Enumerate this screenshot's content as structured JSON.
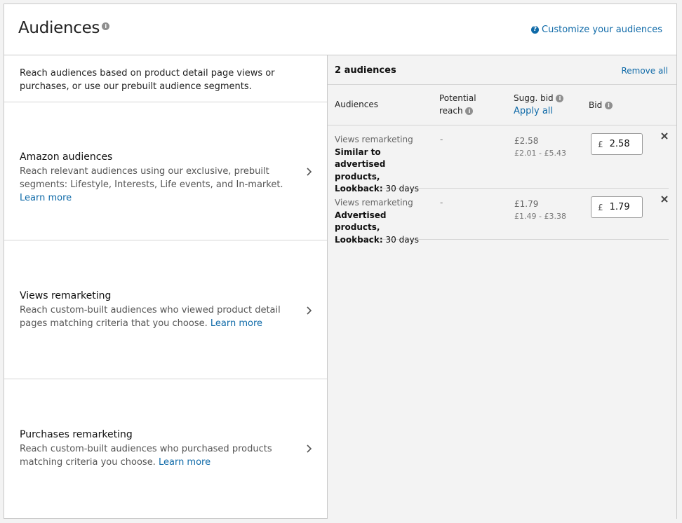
{
  "header": {
    "title": "Audiences",
    "info_icon": "info-icon",
    "customize_label": "Customize your audiences",
    "customize_icon": "help-icon"
  },
  "left": {
    "intro": "Reach audiences based on product detail page views or purchases, or use our prebuilt audience segments.",
    "options": [
      {
        "name": "Amazon audiences",
        "desc": "Reach relevant audiences using our exclusive, prebuilt segments: Lifestyle, Interests, Life events, and In-market.",
        "link": "Learn more"
      },
      {
        "name": "Views remarketing",
        "desc": "Reach custom-built audiences who viewed product detail pages matching criteria that you choose.",
        "link": "Learn more"
      },
      {
        "name": "Purchases remarketing",
        "desc": "Reach custom-built audiences who purchased products matching criteria you choose.",
        "link": "Learn more"
      }
    ]
  },
  "right": {
    "count_label": "2 audiences",
    "remove_all": "Remove all",
    "columns": {
      "audiences": "Audiences",
      "reach_line1": "Potential",
      "reach_line2": "reach",
      "sugg": "Sugg. bid",
      "apply_all": "Apply all",
      "bid": "Bid"
    },
    "rows": [
      {
        "type": "Views remarketing",
        "target": "Similar to advertised products,",
        "lookback_label": "Lookback:",
        "lookback_value": "30 days",
        "reach": "-",
        "sugg_bid": "£2.58",
        "sugg_range": "£2.01 - £5.43",
        "currency": "£",
        "bid": "2.58"
      },
      {
        "type": "Views remarketing",
        "target": "Advertised products,",
        "lookback_label": "Lookback:",
        "lookback_value": "30 days",
        "reach": "-",
        "sugg_bid": "£1.79",
        "sugg_range": "£1.49 - £3.38",
        "currency": "£",
        "bid": "1.79"
      }
    ]
  },
  "colors": {
    "link": "#0f6aa8",
    "border": "#c9c9c9",
    "panel_bg": "#f3f3f3"
  }
}
